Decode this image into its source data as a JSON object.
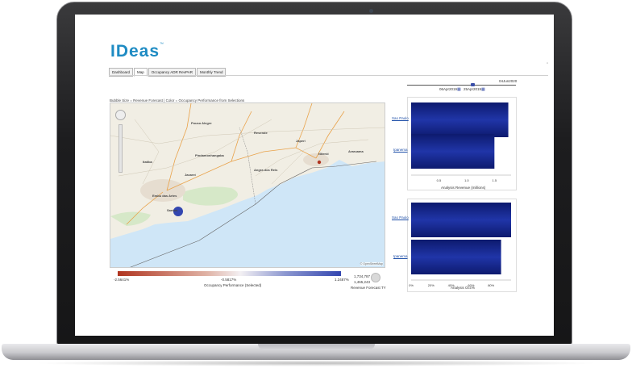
{
  "app": {
    "logo_text": "IDeas",
    "logo_tm": "™",
    "corner_icon": "▫",
    "tabs": [
      {
        "label": "Dashboard"
      },
      {
        "label": "Map"
      },
      {
        "label": "Occupancy ADR RevPAR"
      },
      {
        "label": "Monthly Trend"
      }
    ],
    "active_tab": 1,
    "date_right": "04Jun2020",
    "date_start": "06Apr2019",
    "date_end": "25Apr2019",
    "calendar_icon": "calendar-icon"
  },
  "map": {
    "title": "Bubble Size = Revenue Forecast | Color = Occupancy Performance from Selections",
    "credit": "© OpenStreetMap",
    "labels": [
      {
        "text": "Pouso Alegre"
      },
      {
        "text": "Resende"
      },
      {
        "text": "Pindamonhangaba"
      },
      {
        "text": "Niterói"
      },
      {
        "text": "Araruama"
      },
      {
        "text": "Jacareí"
      },
      {
        "text": "Angra dos Reis"
      },
      {
        "text": "Embu das Artes"
      },
      {
        "text": "Santos"
      },
      {
        "text": "Itatiba"
      },
      {
        "text": "Japeri"
      }
    ],
    "legend": {
      "min": "-2.5641%",
      "mid": "-0.5817%",
      "max": "1.2487%",
      "title": "Occupancy Performance (Selected)",
      "size_values": [
        "1,734,787",
        "1,465,243"
      ],
      "size_title": "Revenue Forecast TY"
    },
    "colors": {
      "water": "#cfe6f7",
      "land": "#f2efe6",
      "bubble_blue": "#3346b0",
      "bubble_red": "#b0341f"
    }
  },
  "chart_data": [
    {
      "type": "bar",
      "orientation": "horizontal",
      "categories": [
        "Sao Paulo",
        "Ipanema"
      ],
      "values": [
        1.75,
        1.5
      ],
      "xlabel": "Analysis Revenue (millions)",
      "xticks": [
        "0.5",
        "1.0",
        "1.5"
      ],
      "xlim": [
        0,
        1.8
      ],
      "color": "#2035a8"
    },
    {
      "type": "bar",
      "orientation": "horizontal",
      "categories": [
        "Sao Paulo",
        "Ipanema"
      ],
      "values": [
        100,
        90
      ],
      "xlabel": "Analysis Occ%",
      "xticks": [
        "0%",
        "20%",
        "40%",
        "60%",
        "80%"
      ],
      "xlim": [
        0,
        100
      ],
      "color": "#2035a8"
    }
  ]
}
